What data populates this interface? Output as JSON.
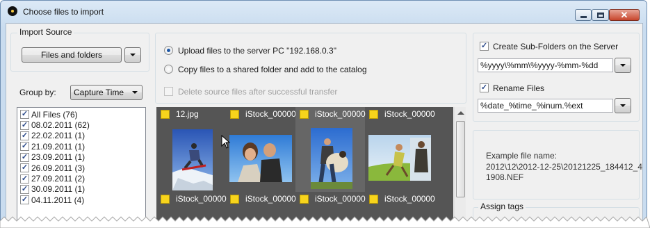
{
  "window": {
    "title": "Choose files to import",
    "controls": [
      "minimize-icon",
      "maximize-icon",
      "close-icon"
    ]
  },
  "import_source": {
    "group_title": "Import Source",
    "source_button": "Files and folders"
  },
  "group_by": {
    "label": "Group by:",
    "selected": "Capture Time"
  },
  "file_list": [
    {
      "label": "All Files (76)",
      "checked": true
    },
    {
      "label": "08.02.2011 (62)",
      "checked": true
    },
    {
      "label": "22.02.2011 (1)",
      "checked": true
    },
    {
      "label": "21.09.2011 (1)",
      "checked": true
    },
    {
      "label": "23.09.2011 (1)",
      "checked": true
    },
    {
      "label": "26.09.2011 (3)",
      "checked": true
    },
    {
      "label": "27.09.2011 (2)",
      "checked": true
    },
    {
      "label": "30.09.2011 (1)",
      "checked": true
    },
    {
      "label": "04.11.2011 (4)",
      "checked": true
    }
  ],
  "upload_options": {
    "upload_label": "Upload files to the server PC \"192.168.0.3\"",
    "copy_label": "Copy files to a shared folder and add to the catalog",
    "delete_label": "Delete source files after successful transfer",
    "selected": "upload",
    "delete_checked": false,
    "delete_enabled": false
  },
  "gallery": {
    "top_row": [
      {
        "name": "12.jpg",
        "has_thumb": true
      },
      {
        "name": "iStock_00000",
        "has_thumb": true
      },
      {
        "name": "iStock_00000",
        "has_thumb": true
      },
      {
        "name": "iStock_00000",
        "has_thumb": true
      }
    ],
    "bottom_row": [
      {
        "name": "iStock_00000"
      },
      {
        "name": "iStock_00000"
      },
      {
        "name": "iStock_00000"
      },
      {
        "name": "iStock_00000"
      }
    ]
  },
  "server_options": {
    "subfolders_label": "Create Sub-Folders on the Server",
    "subfolders_checked": true,
    "subfolders_pattern": "%yyyy\\%mm\\%yyyy-%mm-%dd",
    "rename_label": "Rename Files",
    "rename_checked": true,
    "rename_pattern": "%date_%time_%inum.%ext"
  },
  "example": {
    "label": "Example file name:",
    "value_line1": "2012\\12\\2012-12-25\\20121225_184412_4",
    "value_line2": "1908.NEF"
  },
  "assign_tags": {
    "group_title": "Assign tags"
  }
}
